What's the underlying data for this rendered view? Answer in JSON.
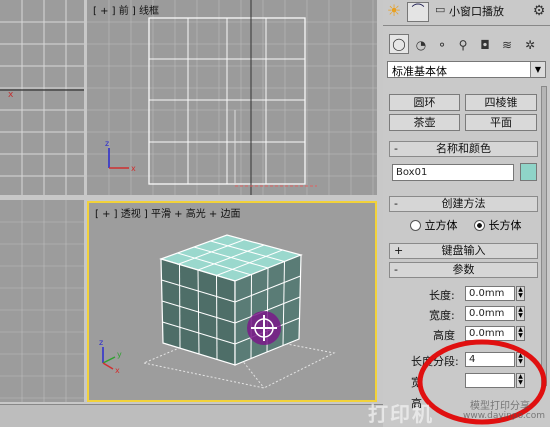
{
  "toolbar": {
    "small_window_label": "小窗口播放"
  },
  "viewports": {
    "front_label": "[ + ] 前 ] 线框",
    "perspective_label": "[ + ] 透视 ] 平滑 + 高光 + 边面",
    "axis_x": "x",
    "axis_y": "y",
    "axis_z": "z"
  },
  "panel": {
    "category_dropdown": "标准基本体",
    "object_buttons": [
      "圆环",
      "四棱锥",
      "茶壶",
      "平面"
    ],
    "rollouts": {
      "name_color": "名称和颜色",
      "creation_method": "创建方法",
      "keyboard_entry": "键盘输入",
      "parameters": "参数"
    },
    "object_name": "Box01",
    "object_color": "#8fd4c8",
    "creation_options": [
      "立方体",
      "长方体"
    ],
    "creation_selected": "长方体",
    "params": {
      "length_label": "长度:",
      "length_value": "0.0mm",
      "width_label": "宽度:",
      "width_value": "0.0mm",
      "height_label": "高度",
      "height_value": "0.0mm",
      "length_segs_label": "长度分段:",
      "length_segs_value": "4",
      "width_segs_label": "宽",
      "height_segs_label": "高"
    }
  },
  "watermark": {
    "brand": "打印机",
    "text": "模型打印分享",
    "url": "www.dayinpo.com"
  },
  "colors": {
    "box_face": "#8fd4c8",
    "active_border": "#f2d23a",
    "annotation_circle": "#e01010",
    "highlight": "#7a1a8a"
  }
}
